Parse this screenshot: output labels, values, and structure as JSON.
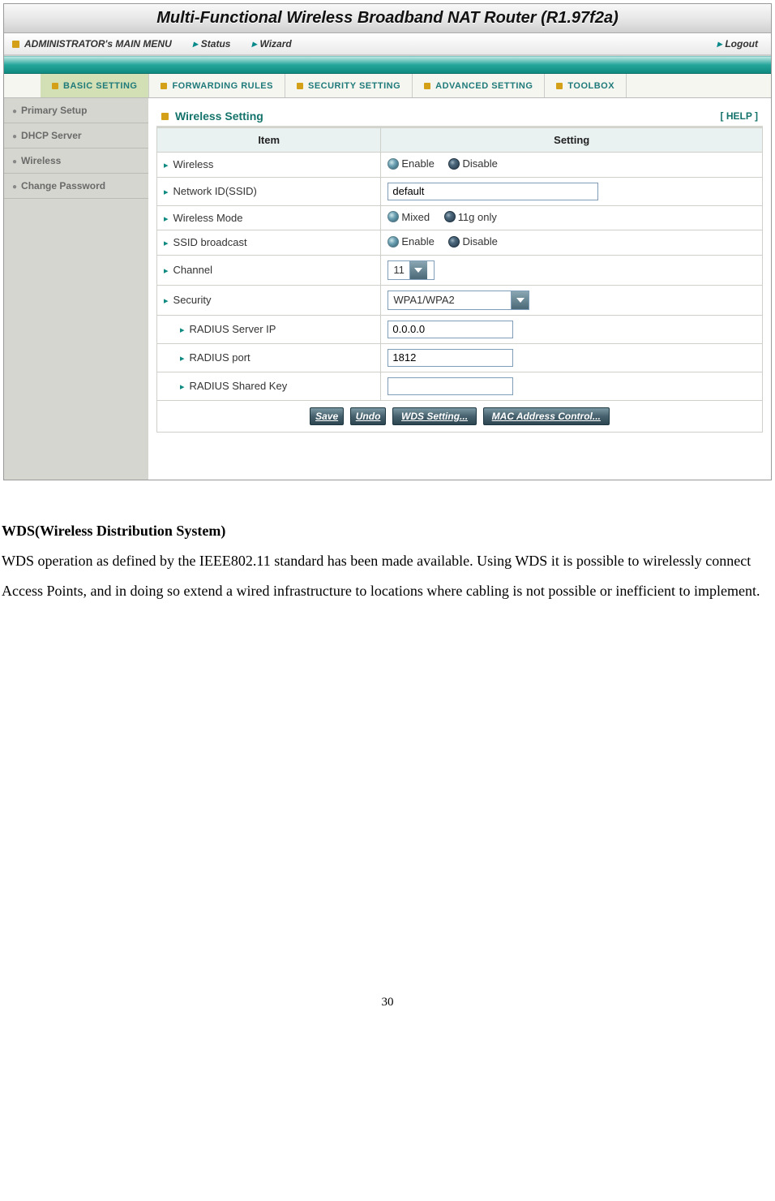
{
  "title": "Multi-Functional Wireless Broadband NAT Router (R1.97f2a)",
  "menu": {
    "main": "ADMINISTRATOR's MAIN MENU",
    "status": "Status",
    "wizard": "Wizard",
    "logout": "Logout"
  },
  "tabs": {
    "basic": "BASIC SETTING",
    "forwarding": "FORWARDING RULES",
    "security": "SECURITY SETTING",
    "advanced": "ADVANCED SETTING",
    "toolbox": "TOOLBOX"
  },
  "sidebar": {
    "primary": "Primary Setup",
    "dhcp": "DHCP Server",
    "wireless": "Wireless",
    "change_pw": "Change Password"
  },
  "panel": {
    "title": "Wireless Setting",
    "help": "[ HELP ]",
    "col_item": "Item",
    "col_setting": "Setting"
  },
  "rows": {
    "wireless": "Wireless",
    "wireless_opt1": "Enable",
    "wireless_opt2": "Disable",
    "ssid": "Network ID(SSID)",
    "ssid_val": "default",
    "mode": "Wireless Mode",
    "mode_opt1": "Mixed",
    "mode_opt2": "11g only",
    "broadcast": "SSID broadcast",
    "broadcast_opt1": "Enable",
    "broadcast_opt2": "Disable",
    "channel": "Channel",
    "channel_val": "11",
    "security": "Security",
    "security_val": "WPA1/WPA2",
    "radius_ip": "RADIUS Server IP",
    "radius_ip_val": "0.0.0.0",
    "radius_port": "RADIUS port",
    "radius_port_val": "1812",
    "radius_key": "RADIUS Shared Key",
    "radius_key_val": ""
  },
  "buttons": {
    "save": "Save",
    "undo": "Undo",
    "wds": "WDS Setting...",
    "mac": "MAC Address Control..."
  },
  "doc": {
    "heading": "WDS(Wireless Distribution System)",
    "p1": "WDS operation as defined by the IEEE802.11 standard has been made available. Using WDS it is possible to wirelessly connect Access Points, and in doing so extend a wired infrastructure to locations where cabling is not possible or inefficient to implement."
  },
  "page_number": "30"
}
